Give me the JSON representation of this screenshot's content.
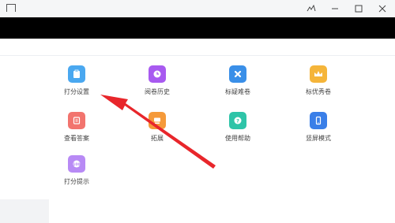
{
  "window": {
    "controls": [
      "pin-icon",
      "minimize-icon",
      "maximize-icon",
      "close-icon"
    ]
  },
  "menu": {
    "items": [
      {
        "label": "打分设置",
        "icon": "clipboard-icon",
        "color": "#4aa8f0"
      },
      {
        "label": "阅卷历史",
        "icon": "clock-icon",
        "color": "#a85af0"
      },
      {
        "label": "标疑难卷",
        "icon": "cross-icon",
        "color": "#3a8fe8"
      },
      {
        "label": "标优秀卷",
        "icon": "crown-icon",
        "color": "#f5b53a"
      },
      {
        "label": "查看答案",
        "icon": "answer-icon",
        "color": "#f2746e"
      },
      {
        "label": "拓展",
        "icon": "expand-icon",
        "color": "#f59a3a"
      },
      {
        "label": "使用帮助",
        "icon": "help-icon",
        "color": "#2ec4a8"
      },
      {
        "label": "竖屏模式",
        "icon": "portrait-icon",
        "color": "#3a7fe8"
      },
      {
        "label": "打分提示",
        "icon": "hint-icon",
        "color": "#b88af5"
      }
    ]
  },
  "annotation": {
    "arrow_color": "#e8262b"
  }
}
